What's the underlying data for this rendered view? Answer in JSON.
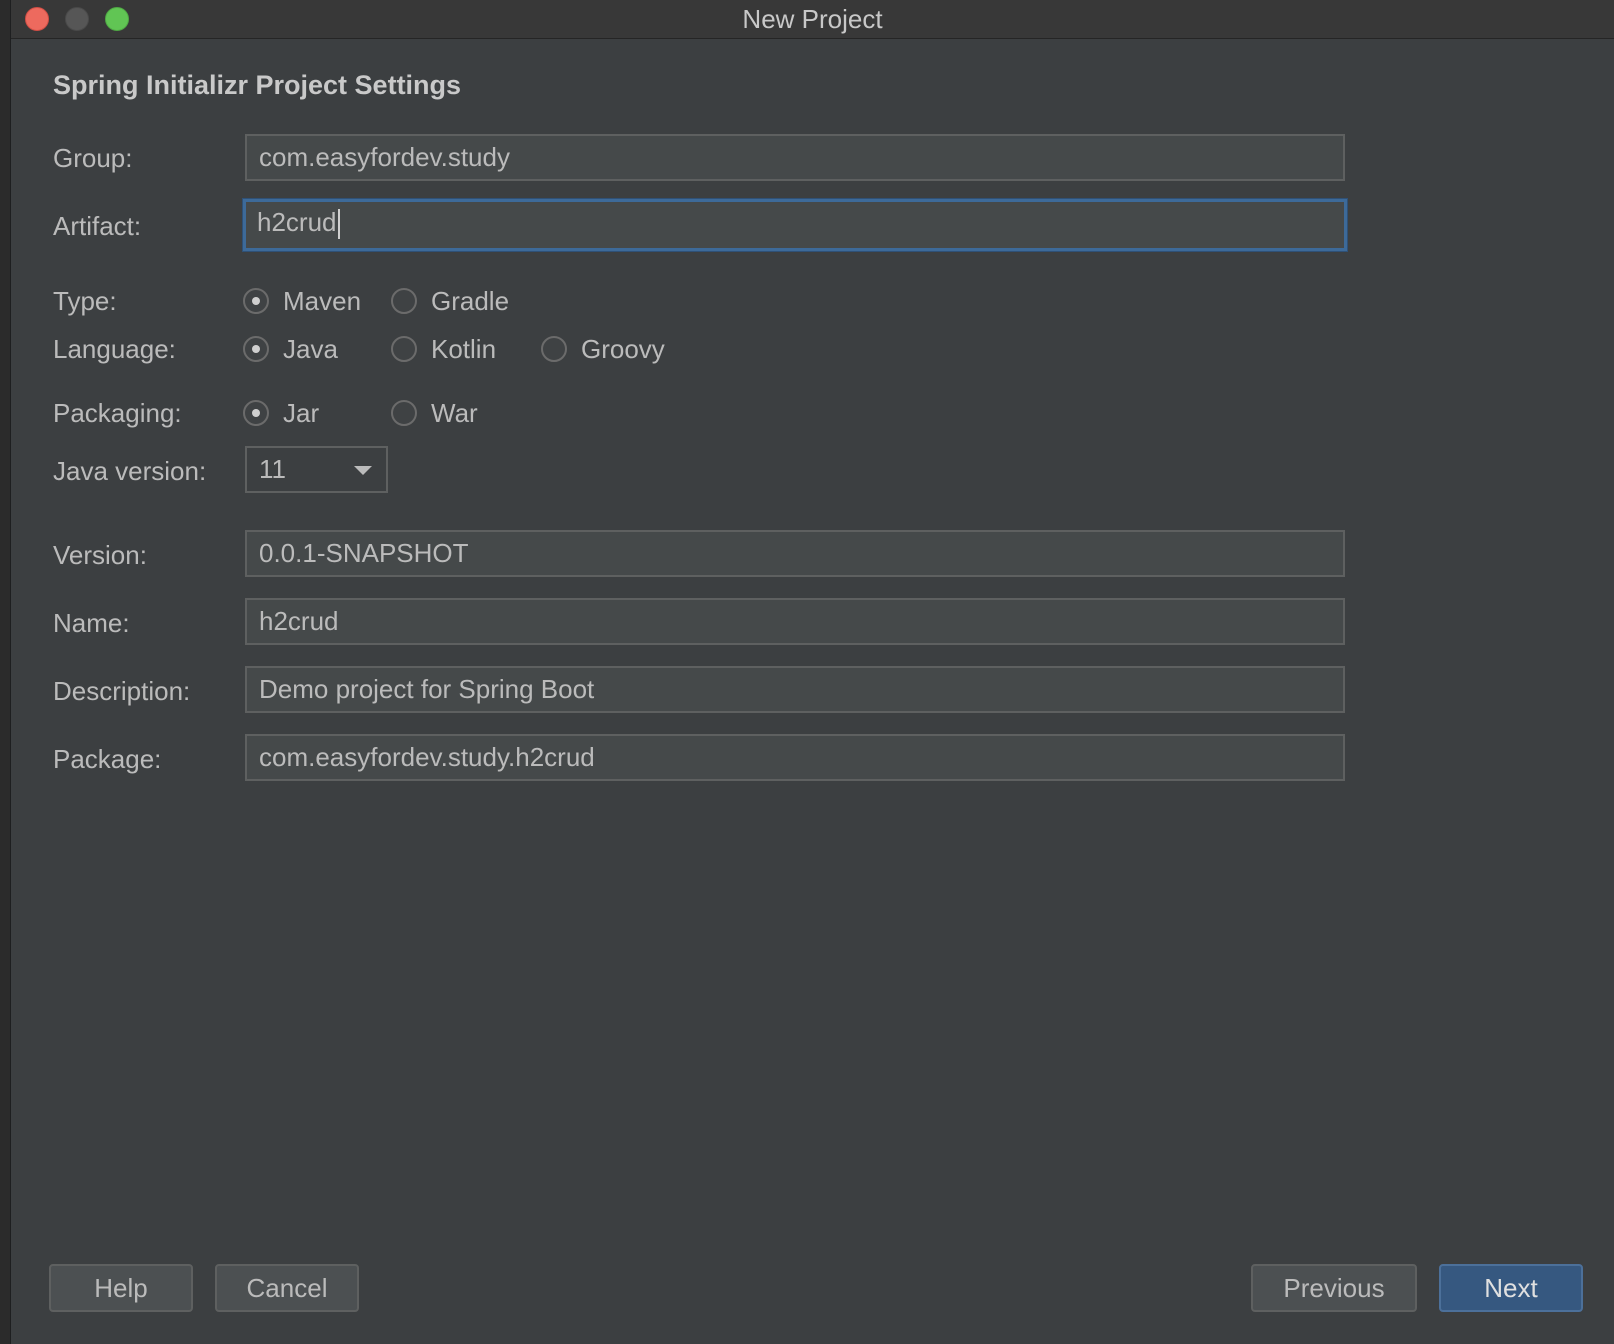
{
  "window": {
    "title": "New Project"
  },
  "form": {
    "section_title": "Spring Initializr Project Settings",
    "group": {
      "label": "Group:",
      "value": "com.easyfordev.study"
    },
    "artifact": {
      "label": "Artifact:",
      "value": "h2crud"
    },
    "type": {
      "label": "Type:",
      "options": [
        "Maven",
        "Gradle"
      ],
      "selected": "Maven"
    },
    "language": {
      "label": "Language:",
      "options": [
        "Java",
        "Kotlin",
        "Groovy"
      ],
      "selected": "Java"
    },
    "packaging": {
      "label": "Packaging:",
      "options": [
        "Jar",
        "War"
      ],
      "selected": "Jar"
    },
    "java_version": {
      "label": "Java version:",
      "value": "11"
    },
    "version": {
      "label": "Version:",
      "value": "0.0.1-SNAPSHOT"
    },
    "name": {
      "label": "Name:",
      "value": "h2crud"
    },
    "description": {
      "label": "Description:",
      "value": "Demo project for Spring Boot"
    },
    "package": {
      "label": "Package:",
      "value": "com.easyfordev.study.h2crud"
    }
  },
  "buttons": {
    "help": "Help",
    "cancel": "Cancel",
    "previous": "Previous",
    "next": "Next"
  },
  "colors": {
    "background": "#3c3f41",
    "field": "#45494a",
    "focus_border": "#3d6a99",
    "primary_button": "#365880",
    "close": "#ed6a5e",
    "zoom": "#61c554"
  }
}
